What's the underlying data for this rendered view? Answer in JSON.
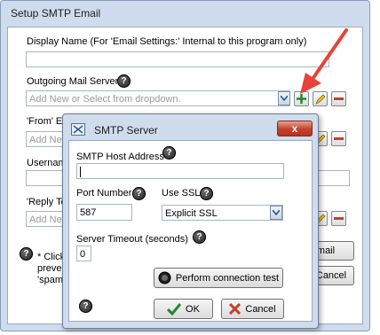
{
  "window": {
    "title": "Setup SMTP Email"
  },
  "form": {
    "display_name_label": "Display Name (For 'Email Settings:' Internal  to this program only)",
    "outgoing_label": "Outgoing Mail Server",
    "outgoing_placeholder": "Add New or Select from dropdown.",
    "from_label": "'From' Em",
    "from_placeholder": "Add New",
    "username_label": "Usernam",
    "reply_label": "'Reply To",
    "reply_placeholder": "Add New",
    "footer_line1": "* Click",
    "footer_line2": "preve",
    "footer_line3": "'spam",
    "mail_button_label": "mail",
    "cancel_button_label": "Cancel"
  },
  "modal": {
    "title": "SMTP Server",
    "close_label": "x",
    "host_label": "SMTP Host Address",
    "host_value": "",
    "port_label": "Port Number",
    "port_value": "587",
    "ssl_label": "Use SSL",
    "ssl_selected": "Explicit SSL",
    "timeout_label": "Server Timeout (seconds)",
    "timeout_value": "0",
    "test_button_label": "Perform connection test",
    "ok_label": "OK",
    "cancel_label": "Cancel"
  },
  "icons": {
    "help": "?"
  },
  "colors": {
    "arrow": "#e8423a",
    "close_button": "#c4402a",
    "window_frame": "#cfdced"
  }
}
